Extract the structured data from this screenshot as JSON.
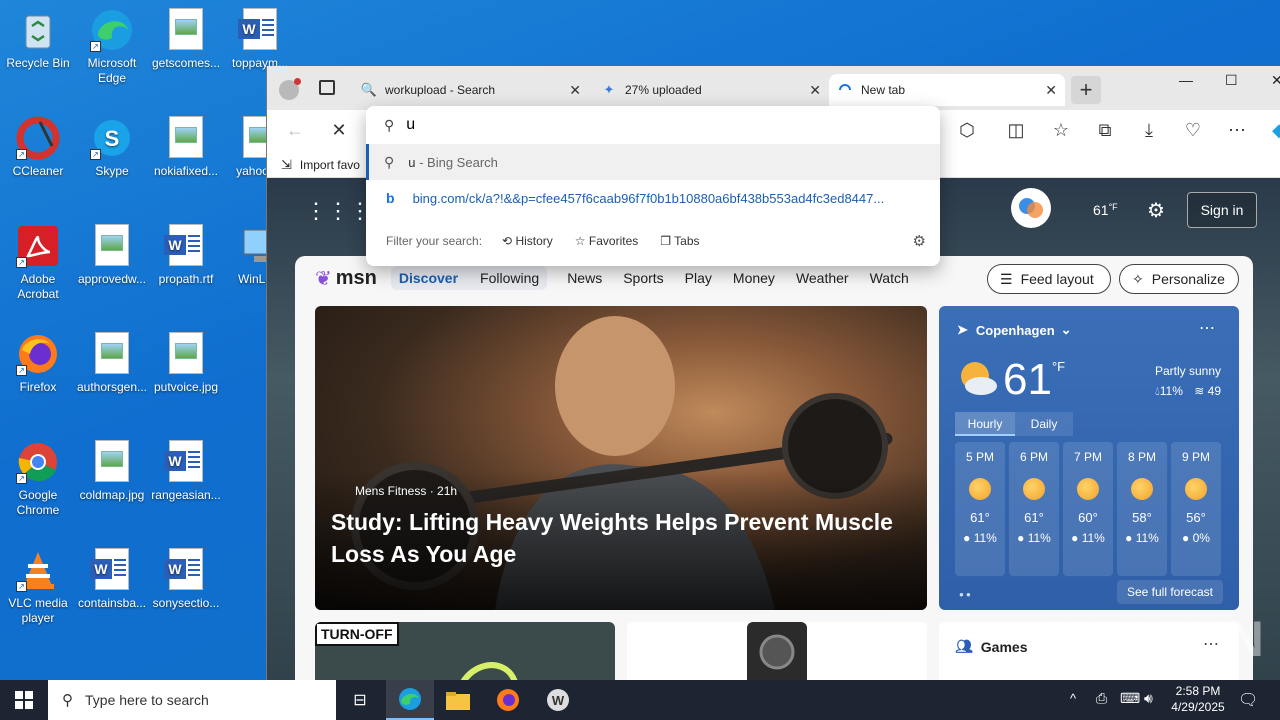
{
  "desktop": {
    "icons": [
      {
        "label": "Recycle Bin"
      },
      {
        "label": "Microsoft Edge"
      },
      {
        "label": "getscomes..."
      },
      {
        "label": "toppaym..."
      },
      {
        "label": "CCleaner"
      },
      {
        "label": "Skype"
      },
      {
        "label": "nokiafixed..."
      },
      {
        "label": "yahoov..."
      },
      {
        "label": "Adobe Acrobat"
      },
      {
        "label": "approvedw..."
      },
      {
        "label": "propath.rtf"
      },
      {
        "label": "WinLo..."
      },
      {
        "label": "Firefox"
      },
      {
        "label": "authorsgen..."
      },
      {
        "label": "putvoice.jpg"
      },
      {
        "label": "Google Chrome"
      },
      {
        "label": "coldmap.jpg"
      },
      {
        "label": "rangeasian..."
      },
      {
        "label": "VLC media player"
      },
      {
        "label": "containsba..."
      },
      {
        "label": "sonysectio..."
      }
    ]
  },
  "browser": {
    "tabs": [
      {
        "label": "workupload - Search"
      },
      {
        "label": "27% uploaded"
      },
      {
        "label": "New tab"
      }
    ],
    "favorites_bar": {
      "import_label": "Import favo"
    },
    "address_value": "u",
    "dropdown": {
      "suggestion_1": "u - Bing Search",
      "suggestion_1_term": "u",
      "suggestion_1_rest": " - Bing Search",
      "suggestion_2": "bing.com/ck/a?!&&p=cfee457f6caab96f7f0b1b10880a6bf438b553ad4fc3ed8447...",
      "filter_label": "Filter your search:",
      "filters": [
        "History",
        "Favorites",
        "Tabs"
      ]
    }
  },
  "newtab": {
    "temp_top": "61",
    "temp_unit_top": "°F",
    "sign_in": "Sign in",
    "msn_logo": "msn",
    "nav": [
      "Discover",
      "Following",
      "News",
      "Sports",
      "Play",
      "Money",
      "Weather",
      "Watch"
    ],
    "feed_layout": "Feed layout",
    "personalize": "Personalize",
    "hero": {
      "source": "Mens Fitness",
      "age": "· 21h",
      "headline": "Study: Lifting Heavy Weights Helps Prevent Muscle Loss As You Age"
    },
    "weather": {
      "city": "Copenhagen",
      "temp": "61",
      "unit": "°F",
      "condition": "Partly sunny",
      "precip": "11%",
      "aqi": "49",
      "tabs": [
        "Hourly",
        "Daily"
      ],
      "hours": [
        {
          "time": "5 PM",
          "temp": "61°",
          "precip": "11%"
        },
        {
          "time": "6 PM",
          "temp": "61°",
          "precip": "11%"
        },
        {
          "time": "7 PM",
          "temp": "60°",
          "precip": "11%"
        },
        {
          "time": "8 PM",
          "temp": "58°",
          "precip": "11%"
        },
        {
          "time": "9 PM",
          "temp": "56°",
          "precip": "0%"
        }
      ],
      "see_full": "See full forecast"
    },
    "cards": {
      "turnoff": "TURN-OFF",
      "games": "Games"
    },
    "watermark": "ANY RUN"
  },
  "taskbar": {
    "search_placeholder": "Type here to search",
    "time": "2:58 PM",
    "date": "4/29/2025"
  }
}
